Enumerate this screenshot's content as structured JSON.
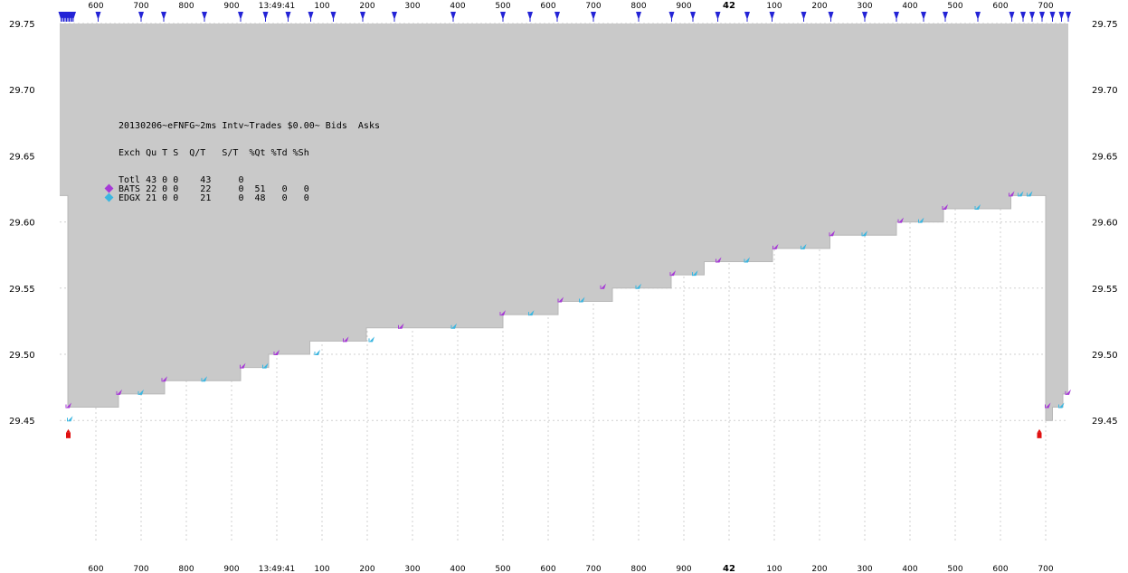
{
  "chart_data": {
    "type": "line",
    "title": "20130206~eFNFG~2ms Intv~Trades $0.00~ Bids  Asks",
    "ylim": [
      29.4,
      29.76
    ],
    "yticks": [
      "29.75",
      "29.70",
      "29.65",
      "29.60",
      "29.55",
      "29.50",
      "29.45"
    ],
    "xlim": [
      560,
      1850
    ],
    "xticks": [
      {
        "x": 600,
        "label": "600"
      },
      {
        "x": 700,
        "label": "700"
      },
      {
        "x": 800,
        "label": "800"
      },
      {
        "x": 900,
        "label": "900"
      },
      {
        "x": 1000,
        "label": "13:49:41"
      },
      {
        "x": 1100,
        "label": "100"
      },
      {
        "x": 1200,
        "label": "200"
      },
      {
        "x": 1300,
        "label": "300"
      },
      {
        "x": 1400,
        "label": "400"
      },
      {
        "x": 1500,
        "label": "500"
      },
      {
        "x": 1600,
        "label": "600"
      },
      {
        "x": 1700,
        "label": "700"
      },
      {
        "x": 1800,
        "label": "800"
      },
      {
        "x": 1900,
        "label": "900"
      },
      {
        "x": 2000,
        "label": "42"
      },
      {
        "x": 2100,
        "label": "100"
      },
      {
        "x": 2200,
        "label": "200"
      },
      {
        "x": 2300,
        "label": "300"
      },
      {
        "x": 2400,
        "label": "400"
      },
      {
        "x": 2500,
        "label": "500"
      },
      {
        "x": 2600,
        "label": "600"
      },
      {
        "x": 2700,
        "label": "700"
      }
    ],
    "bold_tick_label": "42",
    "ask": 29.75,
    "bid_steps": [
      {
        "x": 520,
        "y": 29.62
      },
      {
        "x": 538,
        "y": 29.46
      },
      {
        "x": 650,
        "y": 29.47
      },
      {
        "x": 752,
        "y": 29.48
      },
      {
        "x": 920,
        "y": 29.49
      },
      {
        "x": 982,
        "y": 29.5
      },
      {
        "x": 1073,
        "y": 29.51
      },
      {
        "x": 1198,
        "y": 29.52
      },
      {
        "x": 1500,
        "y": 29.53
      },
      {
        "x": 1622,
        "y": 29.54
      },
      {
        "x": 1742,
        "y": 29.55
      },
      {
        "x": 1872,
        "y": 29.56
      },
      {
        "x": 1945,
        "y": 29.57
      },
      {
        "x": 2096,
        "y": 29.58
      },
      {
        "x": 2223,
        "y": 29.59
      },
      {
        "x": 2370,
        "y": 29.6
      },
      {
        "x": 2474,
        "y": 29.61
      },
      {
        "x": 2623,
        "y": 29.62
      },
      {
        "x": 2700,
        "y": 29.45
      },
      {
        "x": 2715,
        "y": 29.46
      },
      {
        "x": 2738,
        "y": 29.47
      }
    ],
    "bid_end_x": 2750,
    "trades": [
      {
        "x": 538,
        "price": 29.44
      },
      {
        "x": 2685,
        "price": 29.44
      }
    ],
    "quotes": [
      {
        "x": 540,
        "exch": "BATS",
        "price": 29.46
      },
      {
        "x": 543,
        "exch": "EDGX",
        "price": 29.45
      },
      {
        "x": 652,
        "exch": "BATS",
        "price": 29.47
      },
      {
        "x": 700,
        "exch": "EDGX",
        "price": 29.47
      },
      {
        "x": 752,
        "exch": "BATS",
        "price": 29.48
      },
      {
        "x": 840,
        "exch": "EDGX",
        "price": 29.48
      },
      {
        "x": 925,
        "exch": "BATS",
        "price": 29.49
      },
      {
        "x": 975,
        "exch": "EDGX",
        "price": 29.49
      },
      {
        "x": 1000,
        "exch": "BATS",
        "price": 29.5
      },
      {
        "x": 1090,
        "exch": "EDGX",
        "price": 29.5
      },
      {
        "x": 1153,
        "exch": "BATS",
        "price": 29.51
      },
      {
        "x": 1210,
        "exch": "EDGX",
        "price": 29.51
      },
      {
        "x": 1275,
        "exch": "BATS",
        "price": 29.52
      },
      {
        "x": 1392,
        "exch": "EDGX",
        "price": 29.52
      },
      {
        "x": 1500,
        "exch": "BATS",
        "price": 29.53
      },
      {
        "x": 1563,
        "exch": "EDGX",
        "price": 29.53
      },
      {
        "x": 1628,
        "exch": "BATS",
        "price": 29.54
      },
      {
        "x": 1675,
        "exch": "EDGX",
        "price": 29.54
      },
      {
        "x": 1722,
        "exch": "BATS",
        "price": 29.55
      },
      {
        "x": 1800,
        "exch": "EDGX",
        "price": 29.55
      },
      {
        "x": 1876,
        "exch": "BATS",
        "price": 29.56
      },
      {
        "x": 1925,
        "exch": "EDGX",
        "price": 29.56
      },
      {
        "x": 1977,
        "exch": "BATS",
        "price": 29.57
      },
      {
        "x": 2040,
        "exch": "EDGX",
        "price": 29.57
      },
      {
        "x": 2103,
        "exch": "BATS",
        "price": 29.58
      },
      {
        "x": 2165,
        "exch": "EDGX",
        "price": 29.58
      },
      {
        "x": 2228,
        "exch": "BATS",
        "price": 29.59
      },
      {
        "x": 2300,
        "exch": "EDGX",
        "price": 29.59
      },
      {
        "x": 2380,
        "exch": "BATS",
        "price": 29.6
      },
      {
        "x": 2425,
        "exch": "EDGX",
        "price": 29.6
      },
      {
        "x": 2478,
        "exch": "BATS",
        "price": 29.61
      },
      {
        "x": 2550,
        "exch": "EDGX",
        "price": 29.61
      },
      {
        "x": 2625,
        "exch": "BATS",
        "price": 29.62
      },
      {
        "x": 2645,
        "exch": "EDGX",
        "price": 29.62
      },
      {
        "x": 2665,
        "exch": "EDGX",
        "price": 29.62
      },
      {
        "x": 2705,
        "exch": "BATS",
        "price": 29.46
      },
      {
        "x": 2735,
        "exch": "EDGX",
        "price": 29.46
      },
      {
        "x": 2750,
        "exch": "BATS",
        "price": 29.47
      }
    ],
    "top_markers": [
      523,
      526,
      529,
      532,
      535,
      538,
      541,
      544,
      547,
      550,
      605,
      700,
      750,
      840,
      920,
      975,
      1025,
      1075,
      1125,
      1190,
      1260,
      1390,
      1500,
      1560,
      1620,
      1700,
      1800,
      1873,
      1920,
      1975,
      2040,
      2095,
      2165,
      2225,
      2300,
      2370,
      2430,
      2478,
      2550,
      2625,
      2650,
      2670,
      2692,
      2715,
      2735,
      2750
    ],
    "colors": {
      "ask_fill": "#c9c9c9",
      "bid_line": "#000000",
      "grid": "#d0d0d0",
      "BATS": "#a63ad6",
      "EDGX": "#3cb6e0",
      "trade": "#e01010",
      "marker": "#2323d6"
    },
    "legend": {
      "header": "Exch Qu T S  Q/T   S/T  %Qt %Td %Sh",
      "rows": [
        {
          "text": "Totl 43 0 0    43     0",
          "color": ""
        },
        {
          "text": "BATS 22 0 0    22     0  51   0   0",
          "color": "#a63ad6"
        },
        {
          "text": "EDGX 21 0 0    21     0  48   0   0",
          "color": "#3cb6e0"
        }
      ]
    }
  }
}
